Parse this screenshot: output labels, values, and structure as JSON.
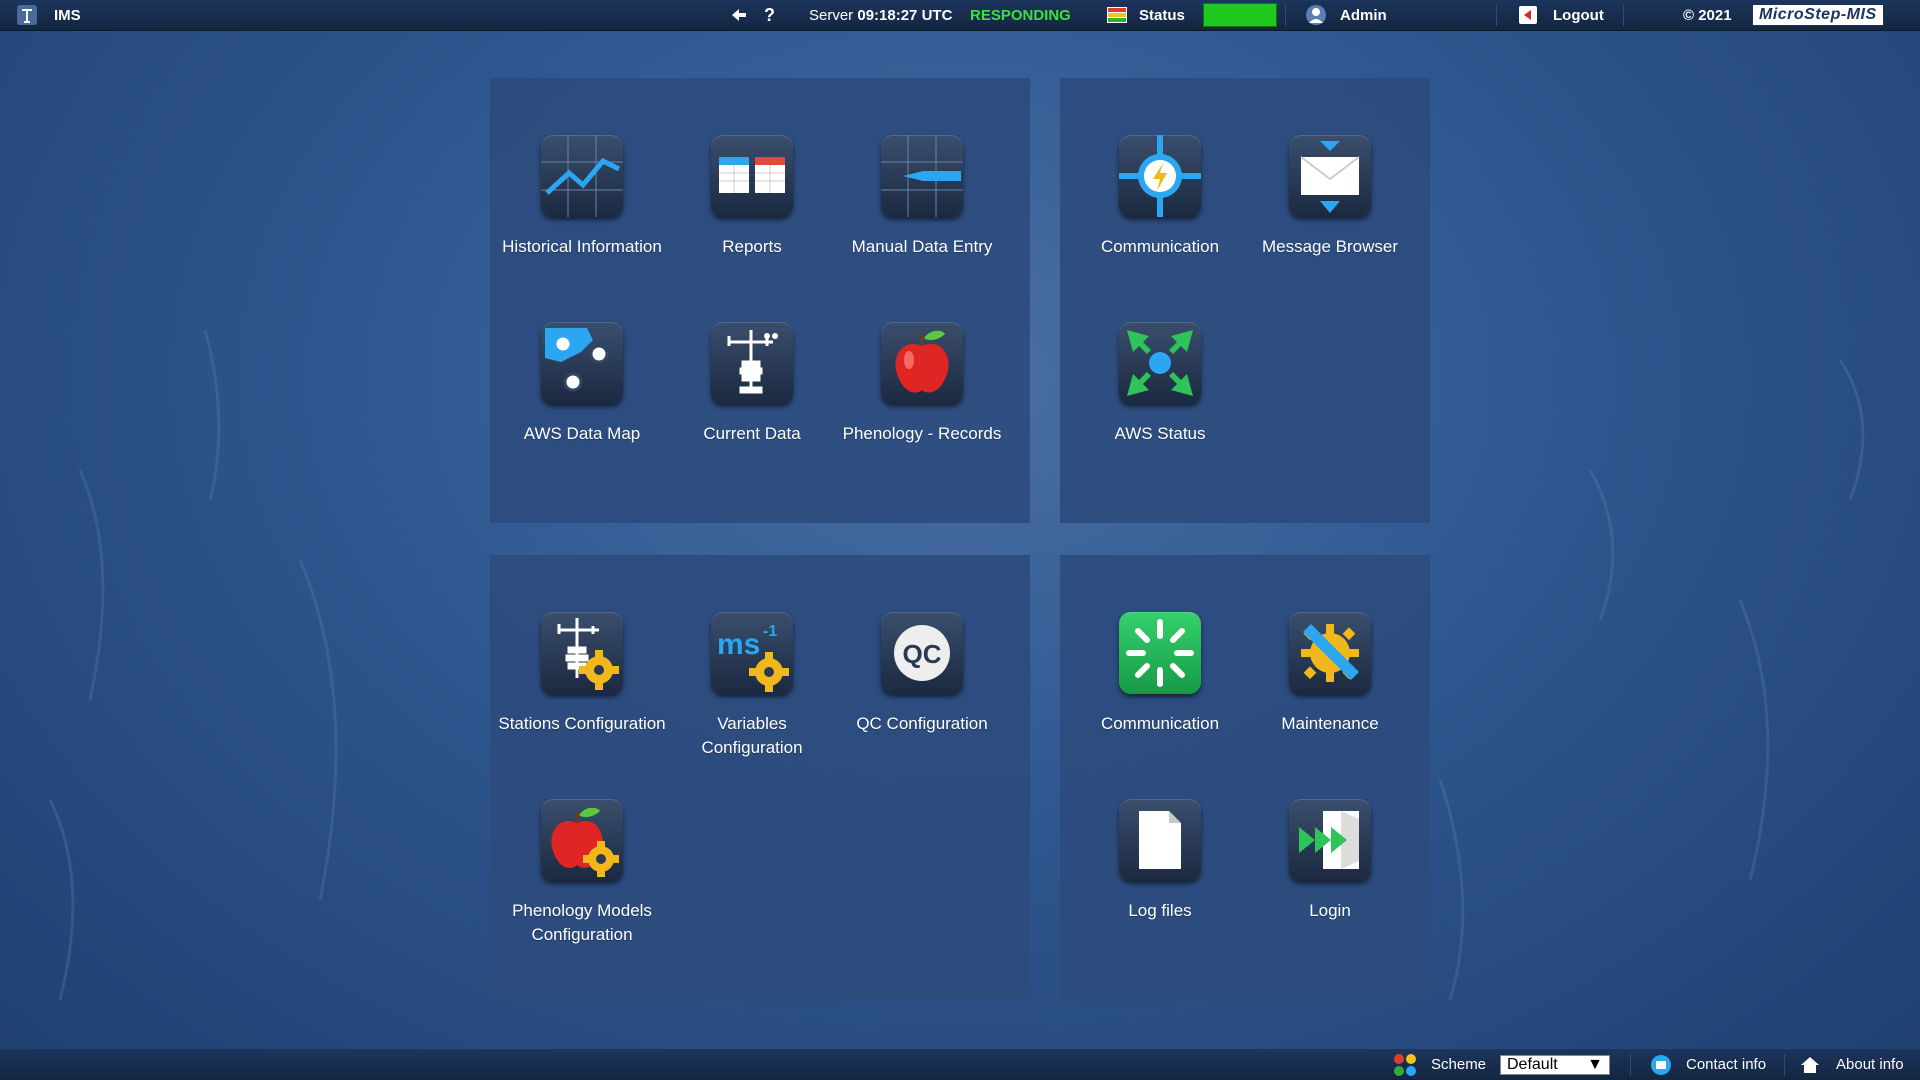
{
  "topbar": {
    "app_name": "IMS",
    "server_label": "Server",
    "server_time": "09:18:27 UTC",
    "server_state": "RESPONDING",
    "status_label": "Status",
    "status_color": "#1fc71f",
    "user": "Admin",
    "logout_label": "Logout",
    "copyright": "© 2021",
    "brand": "MicroStep-MIS"
  },
  "panels": {
    "data": [
      {
        "label": "Historical Information",
        "icon": "chart-line-icon"
      },
      {
        "label": "Reports",
        "icon": "table-icon"
      },
      {
        "label": "Manual Data Entry",
        "icon": "pen-chart-icon"
      },
      {
        "label": "AWS Data Map",
        "icon": "map-icon"
      },
      {
        "label": "Current Data",
        "icon": "weather-station-icon"
      },
      {
        "label": "Phenology - Records",
        "icon": "apple-icon"
      }
    ],
    "comm": [
      {
        "label": "Communication",
        "icon": "lightning-target-icon"
      },
      {
        "label": "Message Browser",
        "icon": "envelope-icon"
      },
      {
        "label": "AWS Status",
        "icon": "arrows-inward-icon"
      }
    ],
    "config": [
      {
        "label": "Stations Configuration",
        "icon": "station-gear-icon"
      },
      {
        "label": "Variables Configuration",
        "icon": "ms-gear-icon"
      },
      {
        "label": "QC Configuration",
        "icon": "qc-icon"
      },
      {
        "label": "Phenology Models Configuration",
        "icon": "apple-gear-icon"
      }
    ],
    "system": [
      {
        "label": "Communication",
        "icon": "loading-burst-icon"
      },
      {
        "label": "Maintenance",
        "icon": "wrench-gear-icon"
      },
      {
        "label": "Log files",
        "icon": "document-icon"
      },
      {
        "label": "Login",
        "icon": "forward-door-icon"
      }
    ]
  },
  "bottombar": {
    "scheme_label": "Scheme",
    "scheme_value": "Default",
    "contact_label": "Contact info",
    "about_label": "About info"
  }
}
